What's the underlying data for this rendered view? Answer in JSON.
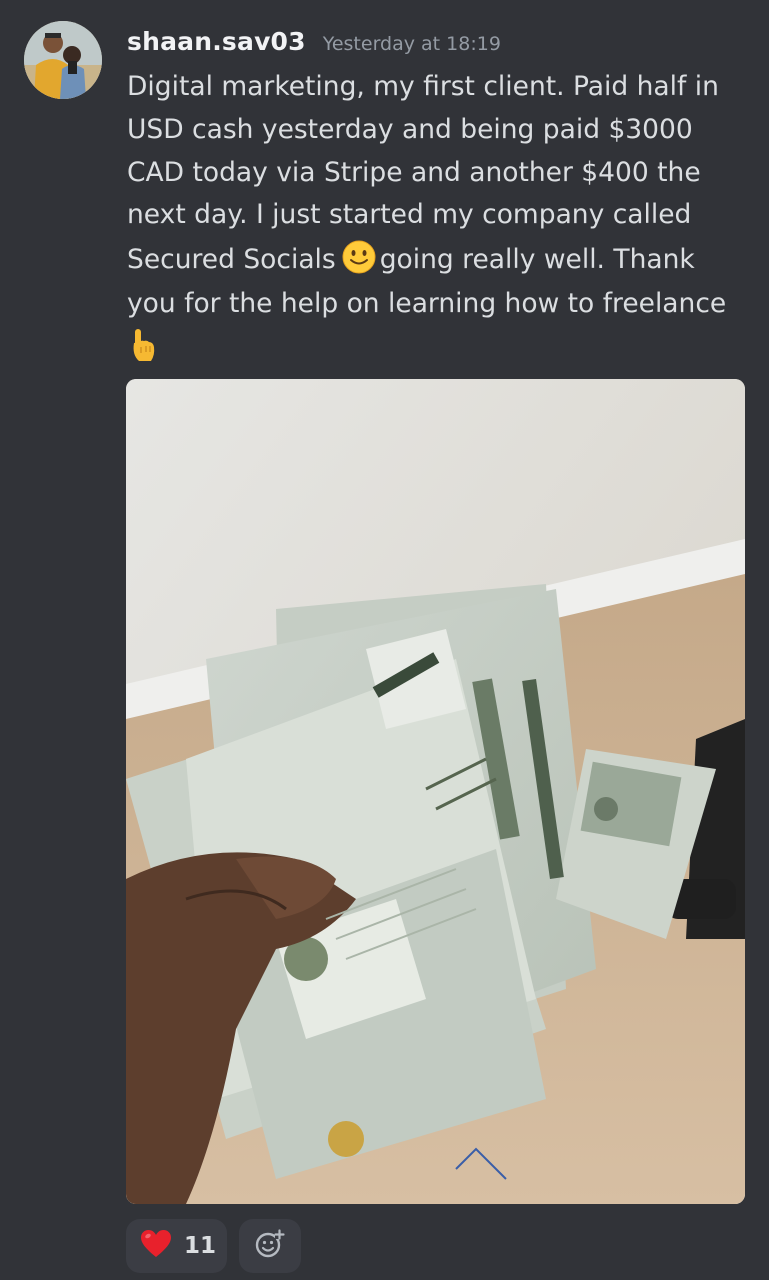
{
  "message": {
    "username": "shaan.sav03",
    "timestamp": "Yesterday at 18:19",
    "lines": [
      "Digital marketing, my first client. Paid half in",
      "USD cash yesterday and being paid $3000",
      "CAD today via Stripe and another $400 the",
      "next day. I just started my company called",
      "Secured Socials",
      "going really well. Thank",
      "you for the help on learning how to freelance"
    ],
    "inline_emoji": "slightly-smiling-face",
    "trailing_emoji": "backhand-index-pointing-up"
  },
  "reactions": [
    {
      "emoji": "red-heart",
      "count": "11"
    }
  ],
  "add_reaction_icon": "add-reaction-icon",
  "colors": {
    "background": "#313338",
    "text": "#dbdee1",
    "username": "#f2f3f5",
    "timestamp": "#949ba4",
    "reaction_bg": "#3b3d44"
  }
}
